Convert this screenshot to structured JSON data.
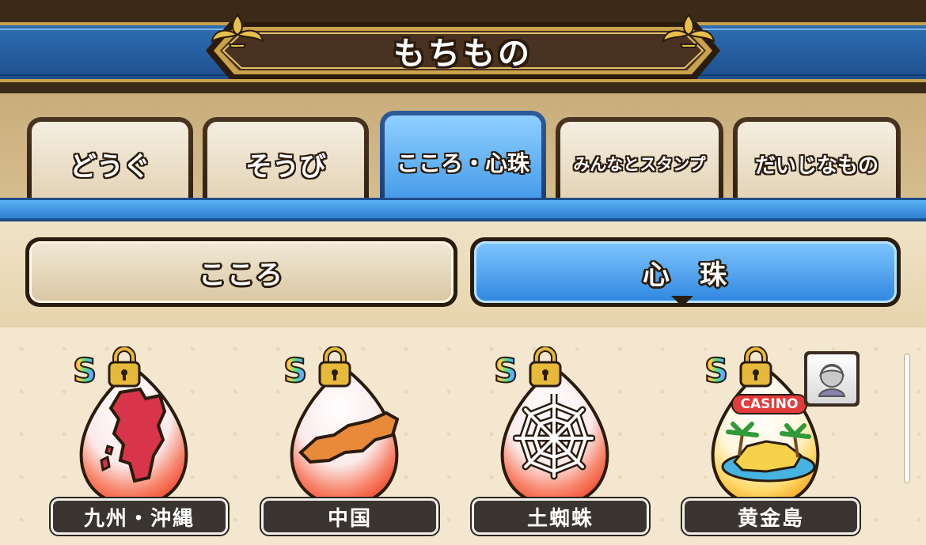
{
  "header": {
    "title": "もちもの"
  },
  "tabs": [
    {
      "label": "どうぐ",
      "active": false
    },
    {
      "label": "そうび",
      "active": false
    },
    {
      "label": "こころ・心珠",
      "active": true
    },
    {
      "label": "みんなとスタンプ",
      "active": false
    },
    {
      "label": "だいじなもの",
      "active": false
    }
  ],
  "subtabs": [
    {
      "label": "こころ",
      "active": false
    },
    {
      "label": "心　珠",
      "active": true
    }
  ],
  "items": [
    {
      "name": "九州・沖縄",
      "rank": "S",
      "locked": true,
      "icon": "kyushu-map-icon",
      "color": "#d8344a"
    },
    {
      "name": "中国",
      "rank": "S",
      "locked": true,
      "icon": "chugoku-map-icon",
      "color": "#e88a3a"
    },
    {
      "name": "土蜘蛛",
      "rank": "S",
      "locked": true,
      "icon": "spider-web-icon",
      "color": "#ffffff"
    },
    {
      "name": "黄金島",
      "rank": "S",
      "locked": true,
      "icon": "casino-island-icon",
      "color": "#f2c94c",
      "badge": "CASINO"
    }
  ],
  "colors": {
    "accent_blue": "#2e86de",
    "brown_dark": "#2a1b0c",
    "gold": "#c9a24a"
  }
}
